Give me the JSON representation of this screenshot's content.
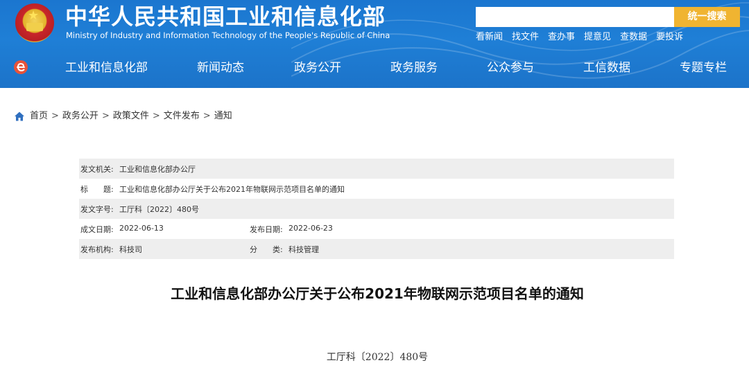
{
  "header": {
    "title": "中华人民共和国工业和信息化部",
    "subtitle": "Ministry of Industry and Information Technology of the People's Republic of China",
    "search": {
      "placeholder": "",
      "button_label": "统一搜索"
    },
    "quick_links": [
      "看新闻",
      "找文件",
      "查办事",
      "提意见",
      "查数据",
      "要投诉"
    ],
    "colors": {
      "header_bg": "#1f7fd6",
      "search_button": "#f0b431"
    }
  },
  "nav": {
    "items": [
      "工业和信息化部",
      "新闻动态",
      "政务公开",
      "政务服务",
      "公众参与",
      "工信数据",
      "专题专栏"
    ]
  },
  "breadcrumb": {
    "items": [
      "首页",
      "政务公开",
      "政策文件",
      "文件发布",
      "通知"
    ],
    "separator": ">"
  },
  "info": {
    "issuer_label": "发文机关:",
    "issuer": "工业和信息化部办公厅",
    "title_label": "标　　题:",
    "title": "工业和信息化部办公厅关于公布2021年物联网示范项目名单的通知",
    "doc_no_label": "发文字号:",
    "doc_no": "工厅科〔2022〕480号",
    "created_label": "成文日期:",
    "created": "2022-06-13",
    "published_label": "发布日期:",
    "published": "2022-06-23",
    "org_label": "发布机构:",
    "org": "科技司",
    "category_label": "分　　类:",
    "category": "科技管理"
  },
  "document": {
    "title": "工业和信息化部办公厅关于公布2021年物联网示范项目名单的通知",
    "number": "工厅科〔2022〕480号"
  }
}
